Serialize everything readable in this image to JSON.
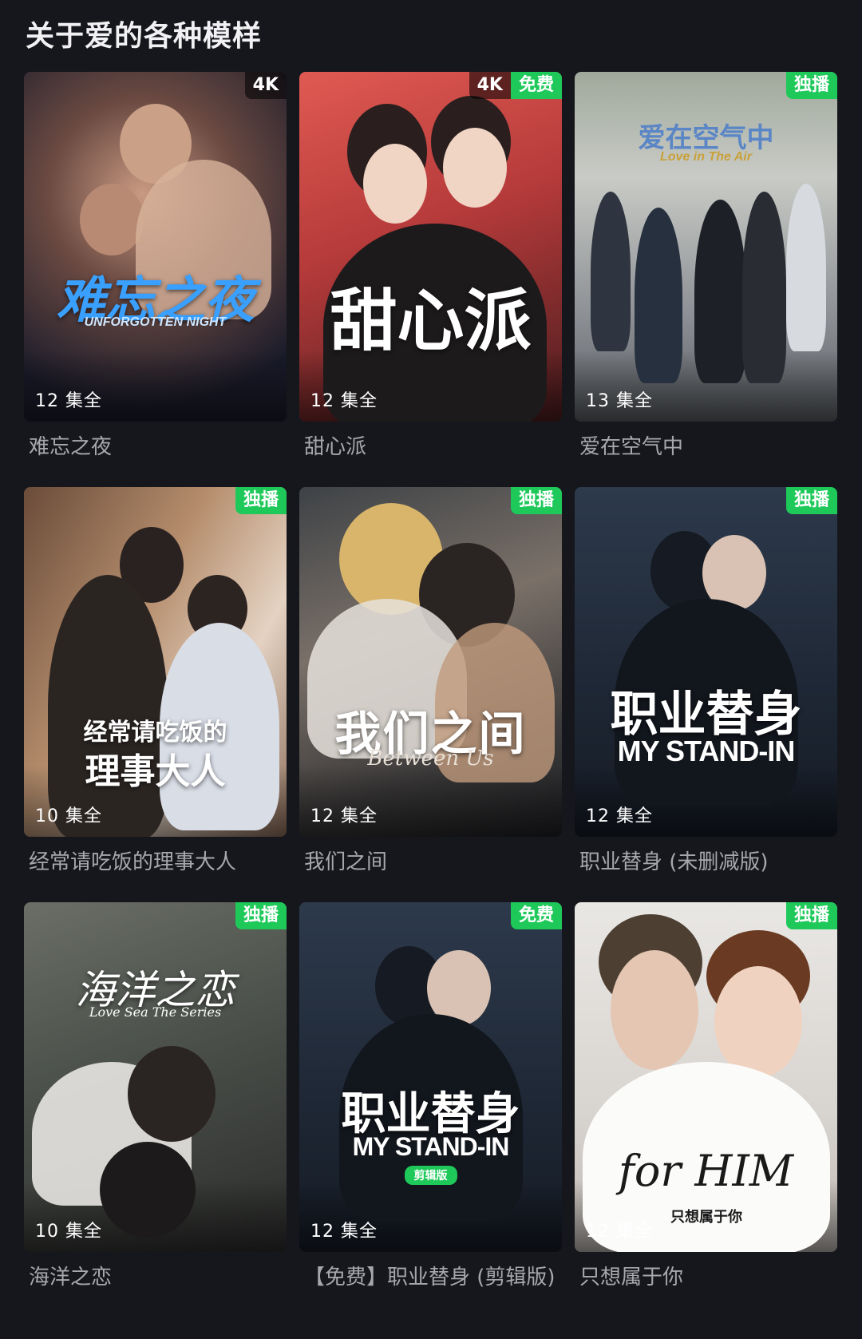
{
  "section": {
    "title": "关于爱的各种模样"
  },
  "cards": [
    {
      "caption": "难忘之夜",
      "episodes": "12 集全",
      "badges": [
        "4K"
      ],
      "poster_title": "难忘之夜",
      "poster_subtitle": "UNFORGOTTEN NIGHT"
    },
    {
      "caption": "甜心派",
      "episodes": "12 集全",
      "badges": [
        "4K",
        "免费"
      ],
      "poster_title": "甜心派",
      "poster_subtitle": ""
    },
    {
      "caption": "爱在空气中",
      "episodes": "13 集全",
      "badges": [
        "独播"
      ],
      "poster_title": "爱在空气中",
      "poster_subtitle": "Love in The Air"
    },
    {
      "caption": "经常请吃饭的理事大人",
      "episodes": "10 集全",
      "badges": [
        "独播"
      ],
      "poster_title": "经常请吃饭的",
      "poster_title2": "理事大人",
      "poster_subtitle": ""
    },
    {
      "caption": "我们之间",
      "episodes": "12 集全",
      "badges": [
        "独播"
      ],
      "poster_title": "我们之间",
      "poster_subtitle": "Between Us"
    },
    {
      "caption": "职业替身 (未删减版)",
      "episodes": "12 集全",
      "badges": [
        "独播"
      ],
      "poster_title": "职业替身",
      "poster_subtitle": "MY STAND-IN"
    },
    {
      "caption": "海洋之恋",
      "episodes": "10 集全",
      "badges": [
        "独播"
      ],
      "poster_title": "海洋之恋",
      "poster_subtitle": "Love Sea The Series"
    },
    {
      "caption": "【免费】职业替身 (剪辑版)",
      "episodes": "12 集全",
      "badges": [
        "免费"
      ],
      "poster_title": "职业替身",
      "poster_subtitle": "MY STAND-IN",
      "poster_tag": "剪辑版"
    },
    {
      "caption": "只想属于你",
      "episodes": "12 集全",
      "badges": [
        "独播"
      ],
      "poster_title": "只想属于你",
      "poster_subtitle": "for HIM"
    }
  ],
  "colors": {
    "background": "#16171c",
    "badge_green": "#1ec95a",
    "caption_text": "#a7a8ad"
  }
}
